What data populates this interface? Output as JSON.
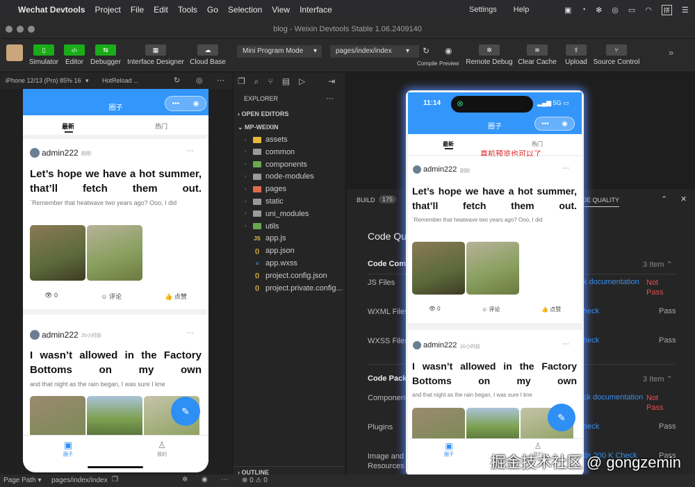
{
  "menubar": {
    "app": "Wechat Devtools",
    "items": [
      "Project",
      "File",
      "Edit",
      "Tools",
      "Go",
      "Selection",
      "View",
      "Interface"
    ],
    "settings": "Settings",
    "help": "Help",
    "input_method": "拼"
  },
  "window": {
    "title": "blog - Weixin Devtools Stable 1.06.2409140"
  },
  "toolbar": {
    "simulator": "Simulator",
    "editor": "Editor",
    "debugger": "Debugger",
    "interface_designer": "Interface Designer",
    "cloud_base": "Cloud Base",
    "mode": "Mini Program Mode",
    "page": "pages/index/index",
    "compile": "Compile",
    "preview": "Preview",
    "remote_debug": "Remote Debug",
    "clear_cache": "Clear Cache",
    "upload": "Upload",
    "source_control": "Source Control"
  },
  "simulator": {
    "device": "iPhone 12/13 (Pro) 85% 16",
    "hotreload": "HotReload ..."
  },
  "app": {
    "nav_title": "圈子",
    "tab_latest": "最新",
    "tab_hot": "热门",
    "time": "11:14",
    "signal": "5G",
    "preview_note": "真机预览也可以了",
    "posts": [
      {
        "user": "admin222",
        "time": "刚刚",
        "title": "Let’s hope we have a hot summer, that’ll fetch them out.",
        "desc": "`Remember that heatwave two years ago? Ooo, I did",
        "views": "0",
        "comment": "评论",
        "like": "点赞"
      },
      {
        "user": "admin222",
        "time": "20小时前",
        "title": "I wasn’t allowed in the Factory Bottoms on my own",
        "desc": "and that night as the rain began, I was sure I kne"
      }
    ],
    "bottom_circle": "圈子",
    "bottom_mine": "我的"
  },
  "explorer": {
    "title": "EXPLORER",
    "open_editors": "OPEN EDITORS",
    "project": "MP-WEIXIN",
    "outline": "OUTLINE",
    "folders": [
      "assets",
      "common",
      "components",
      "node-modules",
      "pages",
      "static",
      "uni_modules",
      "utils"
    ],
    "folder_colors": [
      "#e8b83a",
      "#9a9a9a",
      "#6aa84f",
      "#9a9a9a",
      "#e06c4c",
      "#9a9a9a",
      "#9a9a9a",
      "#6aa84f"
    ],
    "files": [
      {
        "name": "app.js",
        "icon": "JS",
        "color": "#e8c547"
      },
      {
        "name": "app.json",
        "icon": "{}",
        "color": "#e8c547"
      },
      {
        "name": "app.wxss",
        "icon": "≡",
        "color": "#4a9fe8"
      },
      {
        "name": "project.config.json",
        "icon": "{}",
        "color": "#e8c547"
      },
      {
        "name": "project.private.config...",
        "icon": "{}",
        "color": "#e8c547"
      }
    ]
  },
  "panel": {
    "build": "BUILD",
    "build_count": "175",
    "tab": "CODE QUALITY",
    "heading": "Code Qu",
    "section1": "Code Comp",
    "section1_count": "3 Item",
    "section2": "Code Pack",
    "section2_count": "3 Item",
    "rows": [
      {
        "label": "JS Files",
        "link": "k documentation",
        "status": "Not Pass"
      },
      {
        "label": "WXML Files",
        "link": "heck",
        "status": "Pass"
      },
      {
        "label": "WXSS Files",
        "link": "heck",
        "status": "Pass"
      },
      {
        "label": "Component",
        "link": "ck documentation",
        "status": "Not Pass"
      },
      {
        "label": "Plugins",
        "link": "heck",
        "status": "Pass"
      },
      {
        "label": "Image and Resources",
        "link": "ds 200 K Check",
        "status": "Pass"
      }
    ]
  },
  "statusbar": {
    "page_path": "Page Path",
    "path": "pages/index/index",
    "problems": "0",
    "warnings": "0"
  },
  "watermark": "掘金技术社区 @ gongzemin"
}
